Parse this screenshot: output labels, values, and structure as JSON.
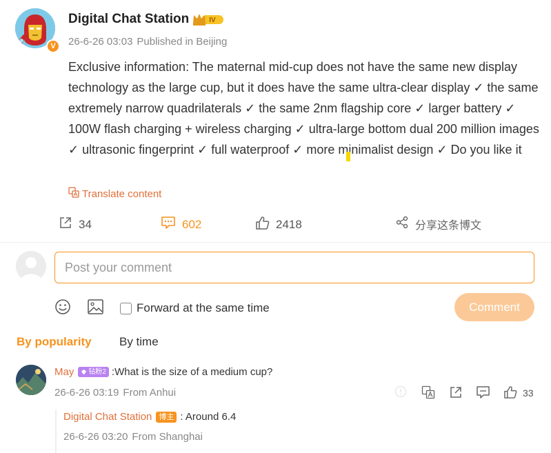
{
  "post": {
    "author": "Digital Chat Station",
    "level_badge": "IV",
    "verified_mark": "V",
    "date": "26-6-26 03:03",
    "location": "Published in Beijing",
    "text": "Exclusive information: The maternal mid-cup does not have the same new display technology as the large cup, but it does have the same ultra-clear display ✓ the same extremely narrow quadrilaterals ✓ the same 2nm flagship core ✓ larger battery ✓ 100W flash charging + wireless charging ✓ ultra-large bottom dual 200 million images ✓ ultrasonic fingerprint ✓ full waterproof ✓ more minimalist design ✓ Do you like it",
    "translate_label": "Translate content"
  },
  "actions": {
    "forward_count": "34",
    "comment_count": "602",
    "like_count": "2418",
    "share_label": "分享这条博文"
  },
  "composer": {
    "placeholder": "Post your comment",
    "forward_label": "Forward at the same time",
    "submit_label": "Comment"
  },
  "sort": {
    "popularity": "By popularity",
    "time": "By time"
  },
  "comments": [
    {
      "name": "May",
      "badge": "钻粉2",
      "text": ":What is the  size of a medium cup?",
      "date": "26-6-26 03:19",
      "location": "From Anhui",
      "likes": "33",
      "reply": {
        "name": "Digital Chat Station",
        "badge": "博主",
        "text": ": Around   6.4",
        "date": "26-6-26 03:20",
        "location": "From Shanghai"
      }
    }
  ],
  "colors": {
    "accent": "#f7931e",
    "name_link": "#e0703a",
    "comment_button": "#fbc998",
    "fan_badge": "#b982f0"
  }
}
